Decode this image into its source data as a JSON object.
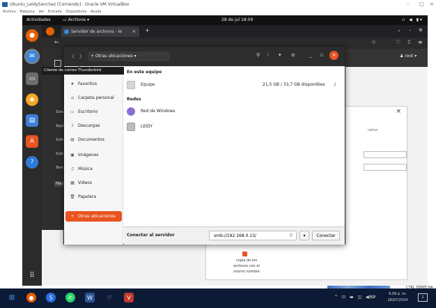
{
  "vbox": {
    "title": "Ubuntu_LeidySanchez [Corriendo] - Oracle VM VirtualBox",
    "menu": [
      "Archivo",
      "Máquina",
      "Ver",
      "Entrada",
      "Dispositivos",
      "Ayuda"
    ],
    "status_right": "CTRL DERECHA"
  },
  "gnome": {
    "activities": "Actividades",
    "app_menu": "Archivos",
    "clock": "28 de jul  18:09"
  },
  "firefox": {
    "tab_title": "Servidor de archivos - le",
    "tab_close": "×",
    "new_tab": "+"
  },
  "tooltip": "Cliente de correo Thunderbird",
  "nautilus": {
    "path_button": "Otras ubicaciones",
    "sidebar": [
      {
        "label": "Recientes",
        "icon": "clock-icon"
      },
      {
        "label": "Favoritos",
        "icon": "star-icon"
      },
      {
        "label": "Carpeta personal",
        "icon": "home-icon"
      },
      {
        "label": "Escritorio",
        "icon": "desktop-icon"
      },
      {
        "label": "Descargas",
        "icon": "download-icon"
      },
      {
        "label": "Documentos",
        "icon": "document-icon"
      },
      {
        "label": "Imágenes",
        "icon": "image-icon"
      },
      {
        "label": "Música",
        "icon": "music-icon"
      },
      {
        "label": "Vídeos",
        "icon": "video-icon"
      },
      {
        "label": "Papelera",
        "icon": "trash-icon"
      },
      {
        "label": "Otras ubicaciones",
        "icon": "plus-icon"
      }
    ],
    "section_this_computer": "En este equipo",
    "equipo_label": "Equipo",
    "equipo_info": "21,5 GB / 33,7 GB disponibles",
    "equipo_mount": "/",
    "section_networks": "Redes",
    "networks": [
      {
        "label": "Red de Windows"
      },
      {
        "label": "LEIDY"
      }
    ],
    "connect_label": "Conectar al servidor",
    "connect_value": "smb://192.168.0.13/",
    "connect_button": "Conectar"
  },
  "background": {
    "left_items": [
      "Siste",
      "Applic",
      "Softw",
      "Subsc",
      "Termi",
      "File se"
    ],
    "dialog_text_lines": [
      "copia de los",
      "archivos con el",
      "mismo nombre"
    ],
    "dialog_close": "×",
    "dialog_partial": "ration",
    "user_menu": "root"
  },
  "taskbar": {
    "lang": "ESP",
    "time": "6:09 p. m.",
    "date": "28/07/2024"
  }
}
